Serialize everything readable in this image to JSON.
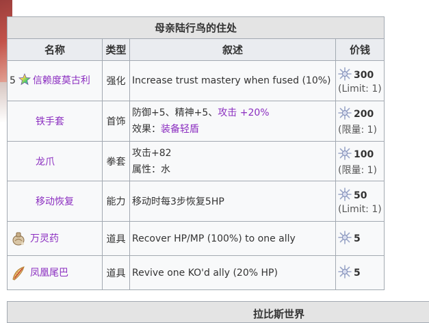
{
  "table": {
    "title": "母亲陆行鸟的住处",
    "headers": {
      "name": "名称",
      "type": "类型",
      "desc": "叙述",
      "price": "价钱"
    },
    "rows": [
      {
        "num": "5",
        "name": "信赖度莫古利",
        "type": "强化",
        "desc1": "Increase trust mastery when fused (10%)",
        "desc2": "",
        "price": "300",
        "limit": "(Limit: 1)",
        "icon": "rainbow-star-icon"
      },
      {
        "name": "铁手套",
        "type": "首饰",
        "desc1_prefix": "防御+5、精神+5、",
        "desc1_link": "攻击 +20%",
        "desc2_prefix": "效果：",
        "desc2_link": "装备轻盾",
        "price": "200",
        "limit": "(限量: 1)"
      },
      {
        "name": "龙爪",
        "type": "拳套",
        "desc1": "攻击+82",
        "desc2": "属性：水",
        "price": "100",
        "limit": "(限量: 1)"
      },
      {
        "name": "移动恢复",
        "type": "能力",
        "desc1": "移动时每3步恢复5HP",
        "price": "50",
        "limit": "(Limit: 1)"
      },
      {
        "name": "万灵药",
        "type": "道具",
        "desc1": "Recover HP/MP (100%) to one ally",
        "price": "5",
        "icon": "elixir-icon"
      },
      {
        "name": "凤凰尾巴",
        "type": "道具",
        "desc1": "Revive one KO'd ally (20% HP)",
        "price": "5",
        "icon": "phoenix-down-icon"
      }
    ]
  },
  "next_section": {
    "title": "拉比斯世界"
  },
  "colors": {
    "link": "#8b2ec0",
    "border": "#a2a9b1",
    "header_bg": "#eaecf0"
  },
  "price_icon": "lapis-crystal-icon"
}
